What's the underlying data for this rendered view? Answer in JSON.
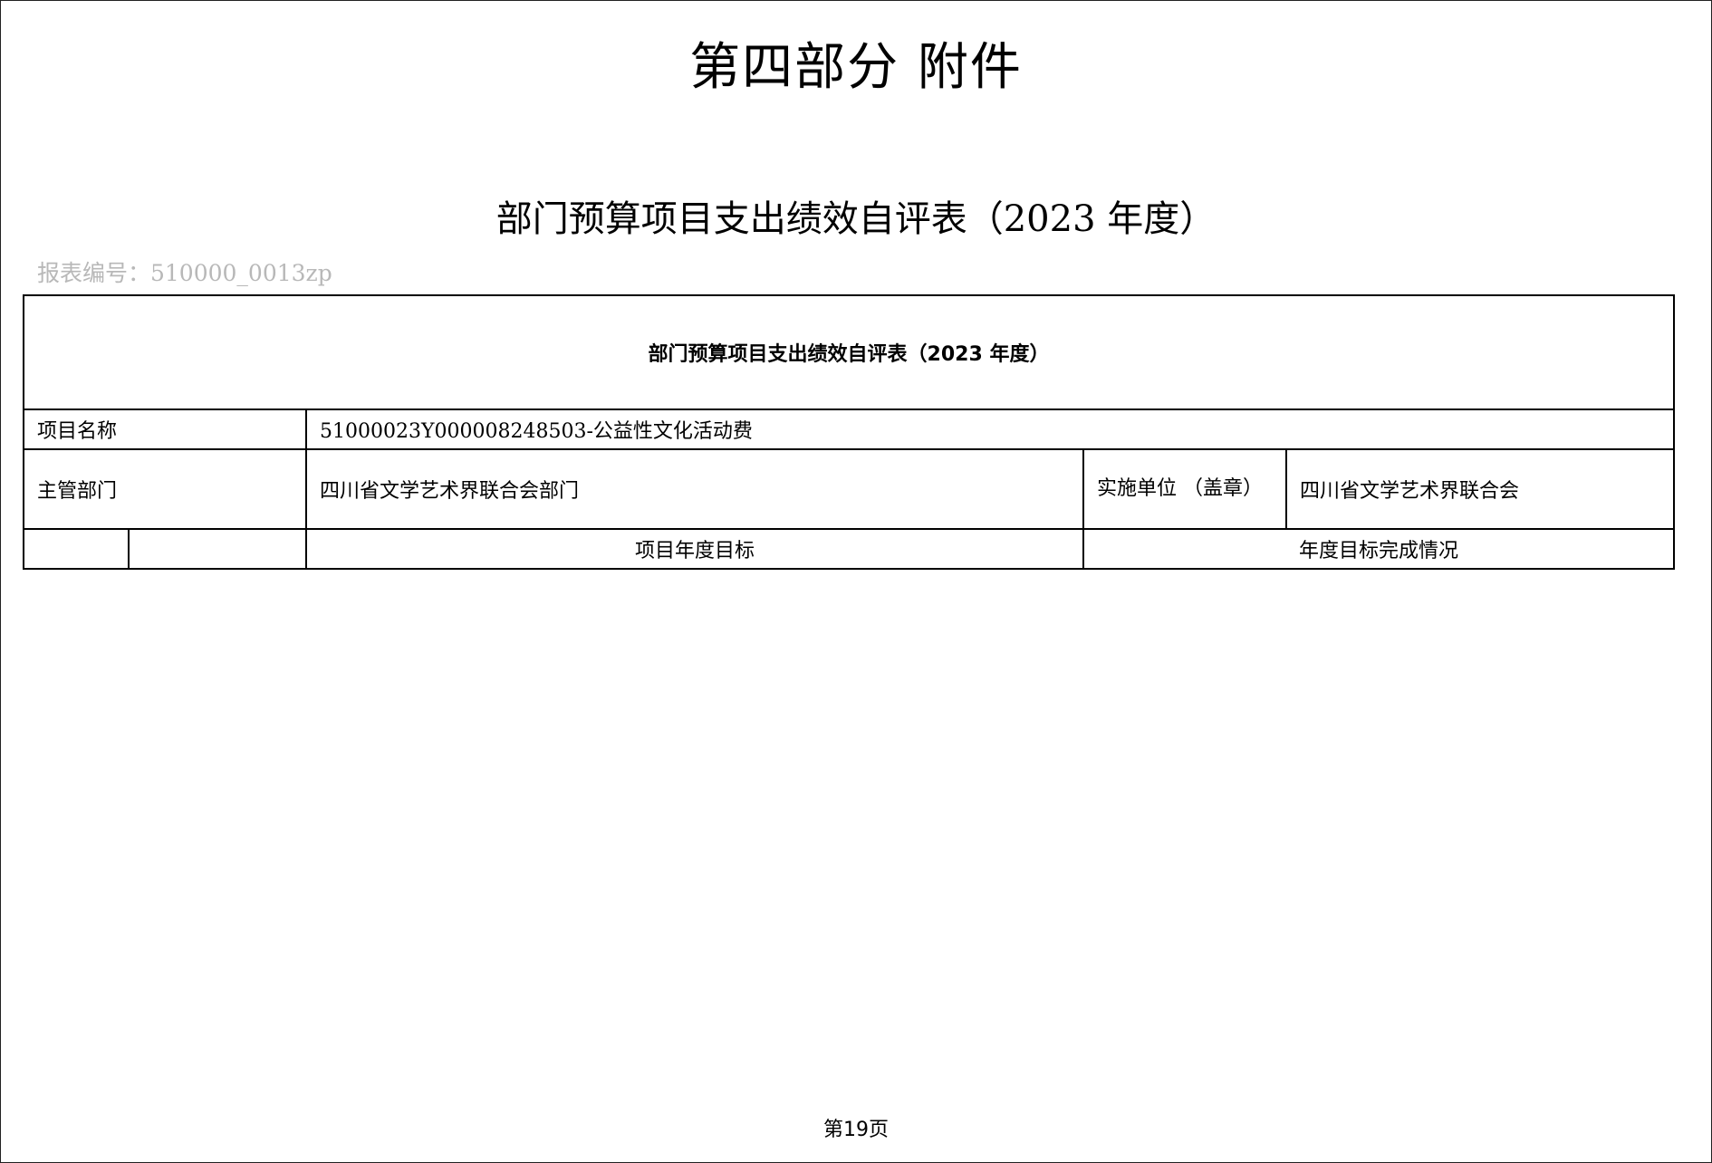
{
  "part_title": "第四部分 附件",
  "table_title": "部门预算项目支出绩效自评表（2023 年度）",
  "report_number": "报表编号：510000_0013zp",
  "form": {
    "heading": "部门预算项目支出绩效自评表（2023 年度）",
    "project_name_label": "项目名称",
    "project_name_value": "51000023Y000008248503-公益性文化活动费",
    "department_label": "主管部门",
    "department_value": "四川省文学艺术界联合会部门",
    "implementing_unit_label": "实施单位 （盖章）",
    "implementing_unit_value": "四川省文学艺术界联合会",
    "annual_goal_header": "项目年度目标",
    "goal_completion_header": "年度目标完成情况"
  },
  "page_footer": "第19页"
}
